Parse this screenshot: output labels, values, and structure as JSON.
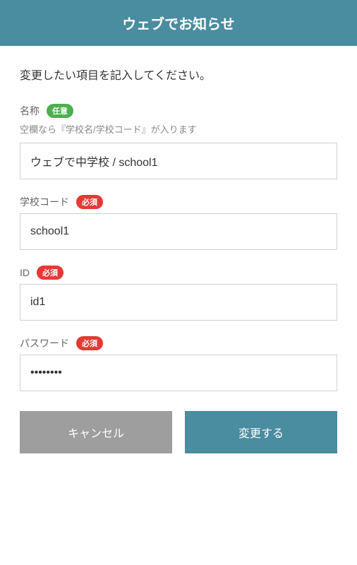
{
  "header": {
    "title": "ウェブでお知らせ"
  },
  "instruction": "変更したい項目を記入してください。",
  "badges": {
    "optional": "任意",
    "required": "必須"
  },
  "fields": {
    "name": {
      "label": "名称",
      "hint": "空欄なら『学校名/学校コード』が入ります",
      "value": "ウェブで中学校 / school1"
    },
    "school_code": {
      "label": "学校コード",
      "value": "school1"
    },
    "id": {
      "label": "ID",
      "value": "id1"
    },
    "password": {
      "label": "パスワード",
      "value": "••••••••"
    }
  },
  "buttons": {
    "cancel": "キャンセル",
    "submit": "変更する"
  }
}
